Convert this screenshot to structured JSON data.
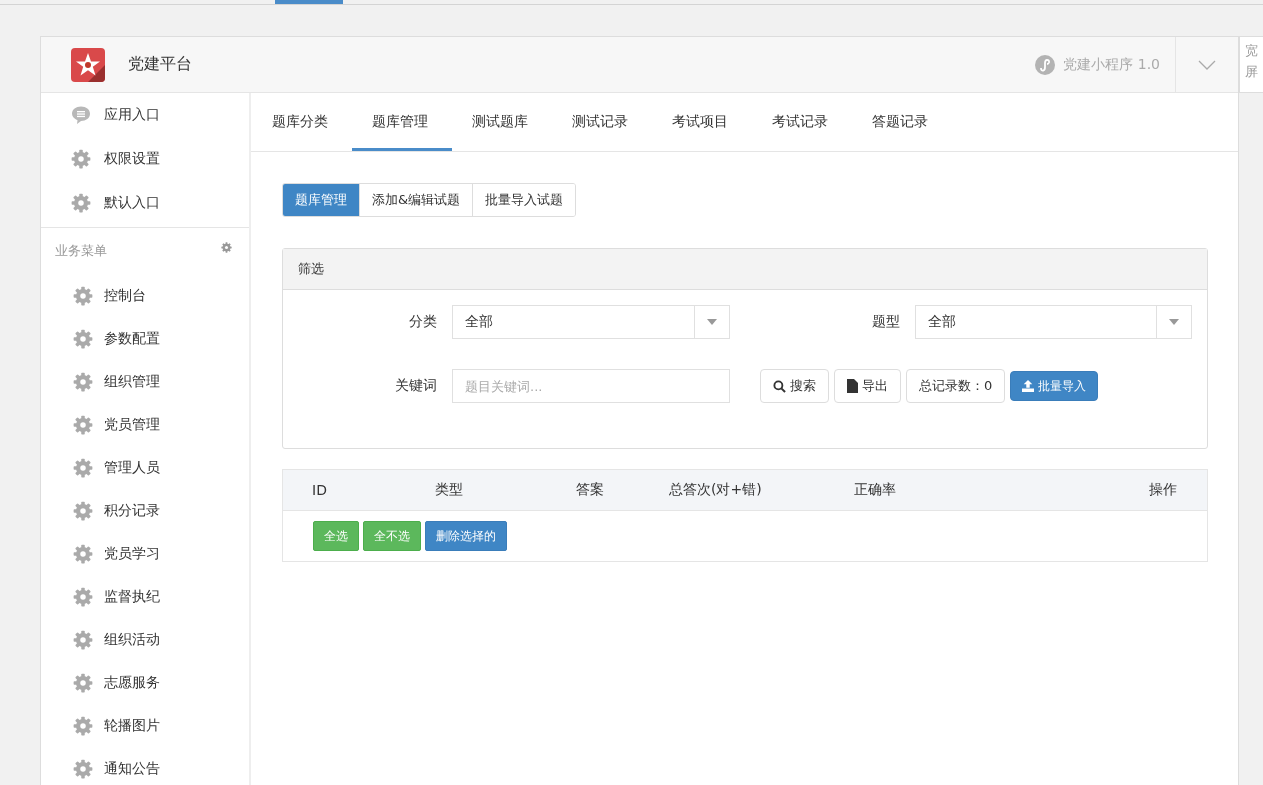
{
  "header": {
    "title": "党建平台",
    "app_label": "党建小程序 1.0",
    "side_toggle": "宽屏"
  },
  "sidebar": {
    "top_items": [
      {
        "label": "应用入口",
        "kind": "chat"
      },
      {
        "label": "权限设置",
        "kind": "gear"
      },
      {
        "label": "默认入口",
        "kind": "gear"
      }
    ],
    "section_title": "业务菜单",
    "menu_items": [
      {
        "label": "控制台"
      },
      {
        "label": "参数配置"
      },
      {
        "label": "组织管理"
      },
      {
        "label": "党员管理"
      },
      {
        "label": "管理人员"
      },
      {
        "label": "积分记录"
      },
      {
        "label": "党员学习"
      },
      {
        "label": "监督执纪"
      },
      {
        "label": "组织活动"
      },
      {
        "label": "志愿服务"
      },
      {
        "label": "轮播图片"
      },
      {
        "label": "通知公告"
      }
    ]
  },
  "tabs": [
    {
      "label": "题库分类",
      "selected": false
    },
    {
      "label": "题库管理",
      "selected": true
    },
    {
      "label": "测试题库",
      "selected": false
    },
    {
      "label": "测试记录",
      "selected": false
    },
    {
      "label": "考试项目",
      "selected": false
    },
    {
      "label": "考试记录",
      "selected": false
    },
    {
      "label": "答题记录",
      "selected": false
    }
  ],
  "sub_tabs": [
    {
      "label": "题库管理",
      "selected": true
    },
    {
      "label": "添加&编辑试题",
      "selected": false
    },
    {
      "label": "批量导入试题",
      "selected": false
    }
  ],
  "filter": {
    "title": "筛选",
    "fields": [
      {
        "kind": "select",
        "label": "分类",
        "value": "全部"
      },
      {
        "kind": "select",
        "label": "题型",
        "value": "全部"
      },
      {
        "kind": "text",
        "label": "关键词",
        "placeholder": "题目关键词..."
      }
    ],
    "actions": [
      {
        "kind": "search",
        "label": "搜索"
      },
      {
        "kind": "export",
        "label": "导出"
      },
      {
        "kind": "count",
        "label": "总记录数：0"
      },
      {
        "kind": "import",
        "label": "批量导入"
      }
    ]
  },
  "table": {
    "columns": [
      "ID",
      "类型",
      "答案",
      "总答次(对+错)",
      "正确率",
      "操作"
    ],
    "actions": [
      {
        "kind": "success",
        "label": "全选"
      },
      {
        "kind": "success",
        "label": "全不选"
      },
      {
        "kind": "primary",
        "label": "删除选择的"
      }
    ]
  }
}
